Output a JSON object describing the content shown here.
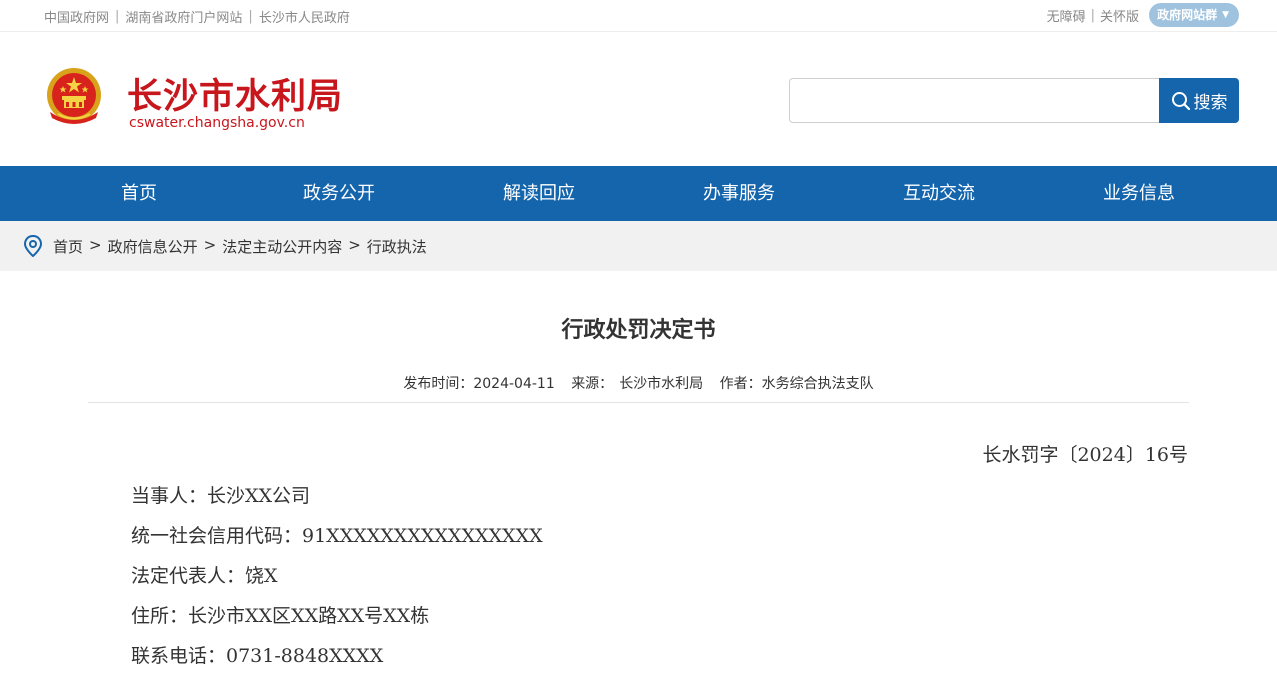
{
  "topbar": {
    "links": [
      "中国政府网",
      "湖南省政府门户网站",
      "长沙市人民政府"
    ],
    "accessibility": "无障碍",
    "elderly": "关怀版",
    "site_group": "政府网站群"
  },
  "header": {
    "title": "长沙市水利局",
    "url": "cswater.changsha.gov.cn",
    "search_placeholder": "",
    "search_label": "搜索"
  },
  "nav": {
    "items": [
      "首页",
      "政务公开",
      "解读回应",
      "办事服务",
      "互动交流",
      "业务信息"
    ]
  },
  "breadcrumb": {
    "items": [
      "首页",
      "政府信息公开",
      "法定主动公开内容",
      "行政执法"
    ],
    "separator": ">"
  },
  "article": {
    "title": "行政处罚决定书",
    "meta": {
      "date_label": "发布时间：2024-04-11",
      "source_label": "来源：",
      "source_value": "长沙市水利局",
      "author_label": "作者：",
      "author_value": "水务综合执法支队"
    },
    "doc_number": "长水罚字〔2024〕16号",
    "lines": [
      "当事人：长沙XX公司",
      "统一社会信用代码：91XXXXXXXXXXXXXXXX",
      "法定代表人：饶X",
      "住所：长沙市XX区XX路XX号XX栋",
      "联系电话：0731-8848XXXX"
    ]
  },
  "colors": {
    "brand_blue": "#1565ad",
    "brand_red": "#c8161d",
    "site_group_bg": "#9fc3df"
  }
}
